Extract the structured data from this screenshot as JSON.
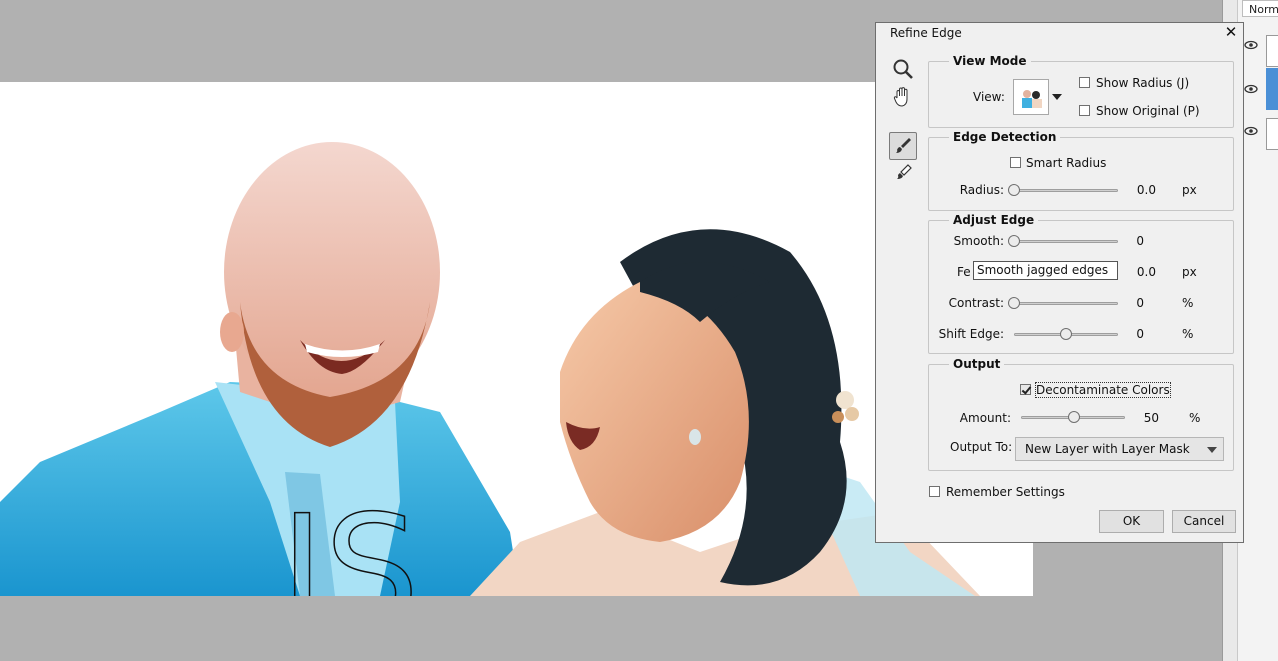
{
  "canvas": {
    "overlay_text": "IS"
  },
  "right_panel": {
    "blend_mode": "Normal"
  },
  "dialog": {
    "title": "Refine Edge",
    "close_glyph": "✕",
    "view_mode": {
      "title": "View Mode",
      "view_label": "View:",
      "show_radius_label": "Show Radius (J)",
      "show_radius_checked": false,
      "show_original_label": "Show Original (P)",
      "show_original_checked": false
    },
    "edge_detection": {
      "title": "Edge Detection",
      "smart_radius_label": "Smart Radius",
      "smart_radius_checked": false,
      "radius_label": "Radius:",
      "radius_value": "0.0",
      "radius_unit": "px"
    },
    "adjust_edge": {
      "title": "Adjust Edge",
      "smooth_label": "Smooth:",
      "smooth_value": "0",
      "feather_label_visible": "Fe",
      "feather_value": "0.0",
      "feather_unit": "px",
      "tooltip": "Smooth jagged edges",
      "contrast_label": "Contrast:",
      "contrast_value": "0",
      "contrast_unit": "%",
      "shift_edge_label": "Shift Edge:",
      "shift_edge_value": "0",
      "shift_edge_unit": "%"
    },
    "output": {
      "title": "Output",
      "decontaminate_label": "Decontaminate Colors",
      "decontaminate_checked": true,
      "amount_label": "Amount:",
      "amount_value": "50",
      "amount_unit": "%",
      "output_to_label": "Output To:",
      "output_to_value": "New Layer with Layer Mask"
    },
    "remember_settings_label": "Remember Settings",
    "remember_settings_checked": false,
    "ok_label": "OK",
    "cancel_label": "Cancel"
  }
}
